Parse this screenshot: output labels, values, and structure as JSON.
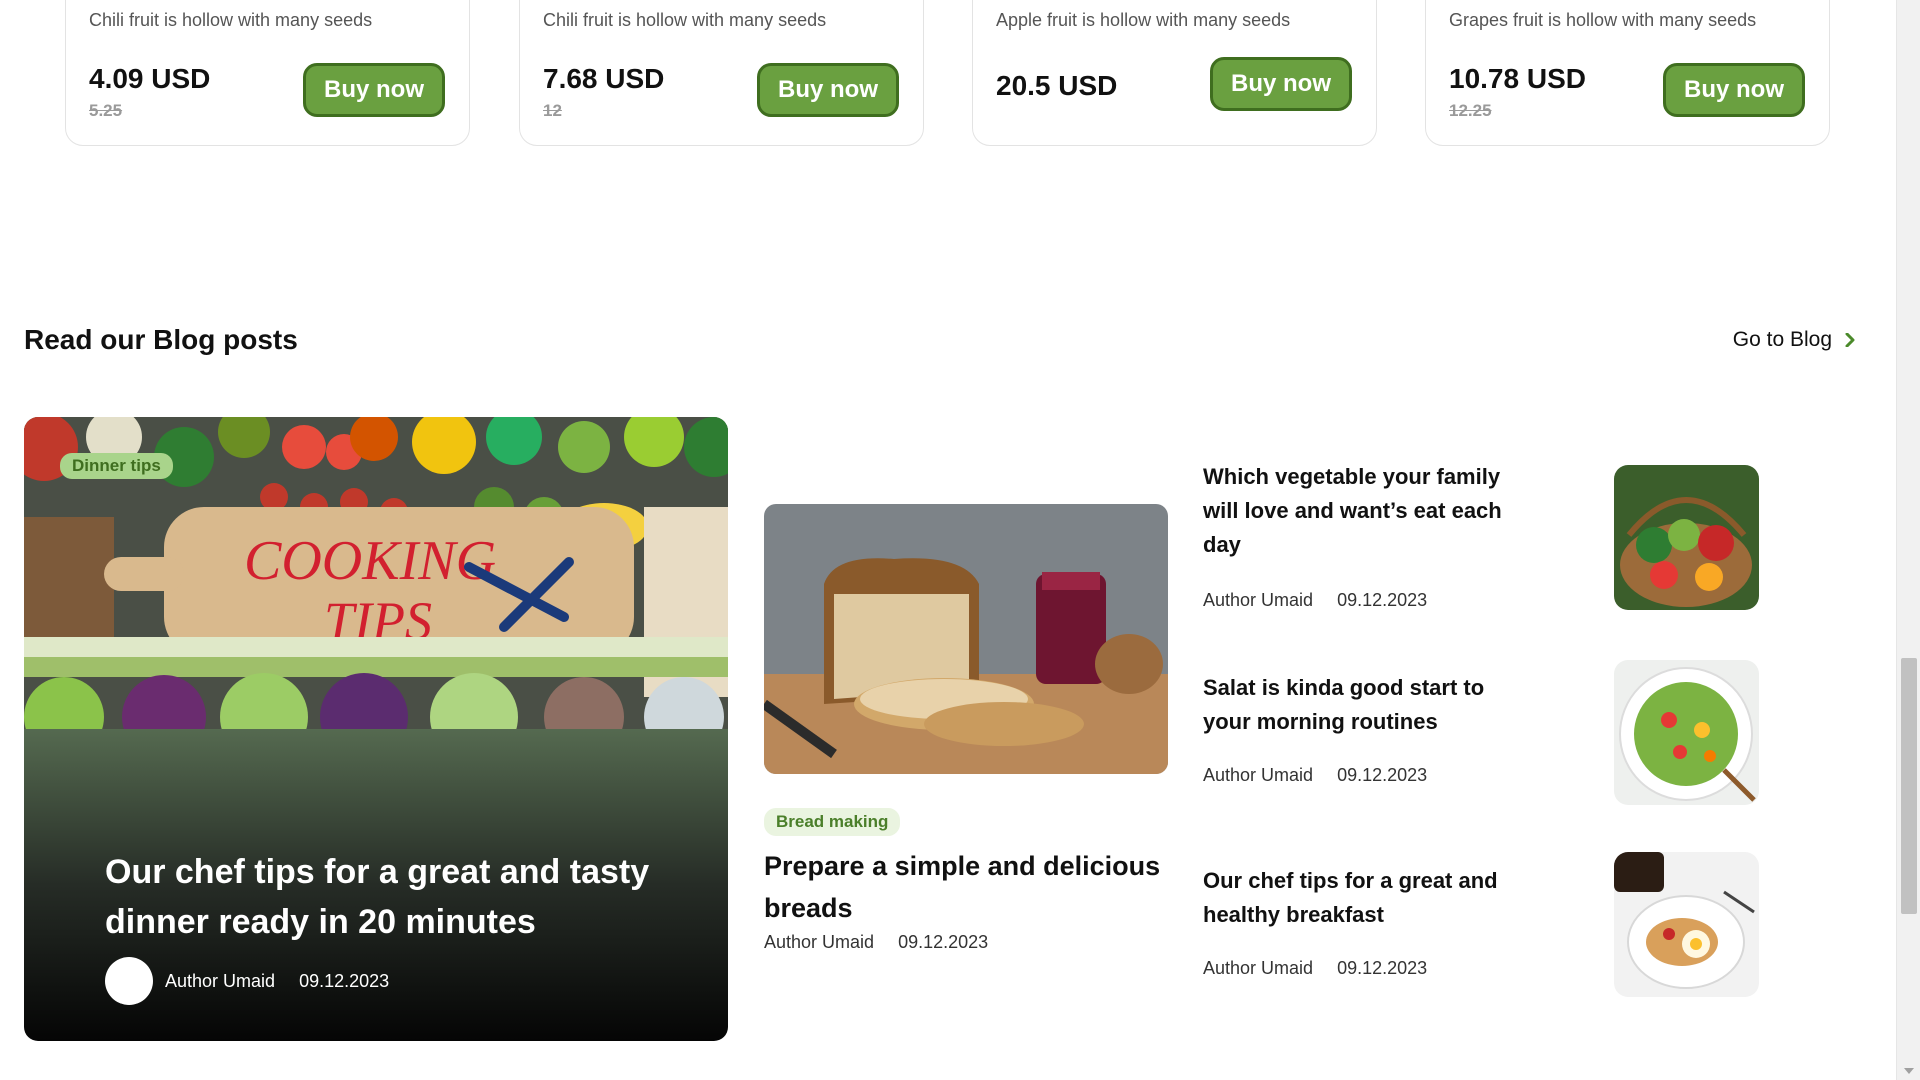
{
  "products": [
    {
      "desc": "Chili fruit is hollow with many seeds",
      "price": "4.09 USD",
      "old_price": "5.25",
      "buy": "Buy now"
    },
    {
      "desc": "Chili fruit is hollow with many seeds",
      "price": "7.68 USD",
      "old_price": "12",
      "buy": "Buy now"
    },
    {
      "desc": "Apple fruit is hollow with many seeds",
      "price": "20.5 USD",
      "old_price": "",
      "buy": "Buy now"
    },
    {
      "desc": "Grapes fruit is hollow with many seeds",
      "price": "10.78 USD",
      "old_price": "12.25",
      "buy": "Buy now"
    }
  ],
  "blog": {
    "title": "Read our Blog posts",
    "go_to_blog": "Go to Blog",
    "featured": {
      "tag": "Dinner tips",
      "image_text": "COOKING TIPS",
      "title": "Our chef tips for a great and tasty dinner ready in 20 minutes",
      "author": "Author Umaid",
      "date": "09.12.2023"
    },
    "middle": {
      "tag": "Bread making",
      "title": "Prepare a simple and delicious breads",
      "author": "Author Umaid",
      "date": "09.12.2023"
    },
    "side": [
      {
        "title": "Which vegetable your family will love and want’s eat each day",
        "author": "Author Umaid",
        "date": "09.12.2023",
        "image": "vegetable-basket"
      },
      {
        "title": "Salat is kinda good start to your morning routines",
        "author": "Author Umaid",
        "date": "09.12.2023",
        "image": "salad-bowl"
      },
      {
        "title": "Our chef tips for a great and healthy breakfast",
        "author": "Author Umaid",
        "date": "09.12.2023",
        "image": "breakfast-plate"
      }
    ]
  },
  "colors": {
    "accent": "#6aa040",
    "accent_dark": "#3f6e1f",
    "tag_bg": "#a9d48b"
  }
}
